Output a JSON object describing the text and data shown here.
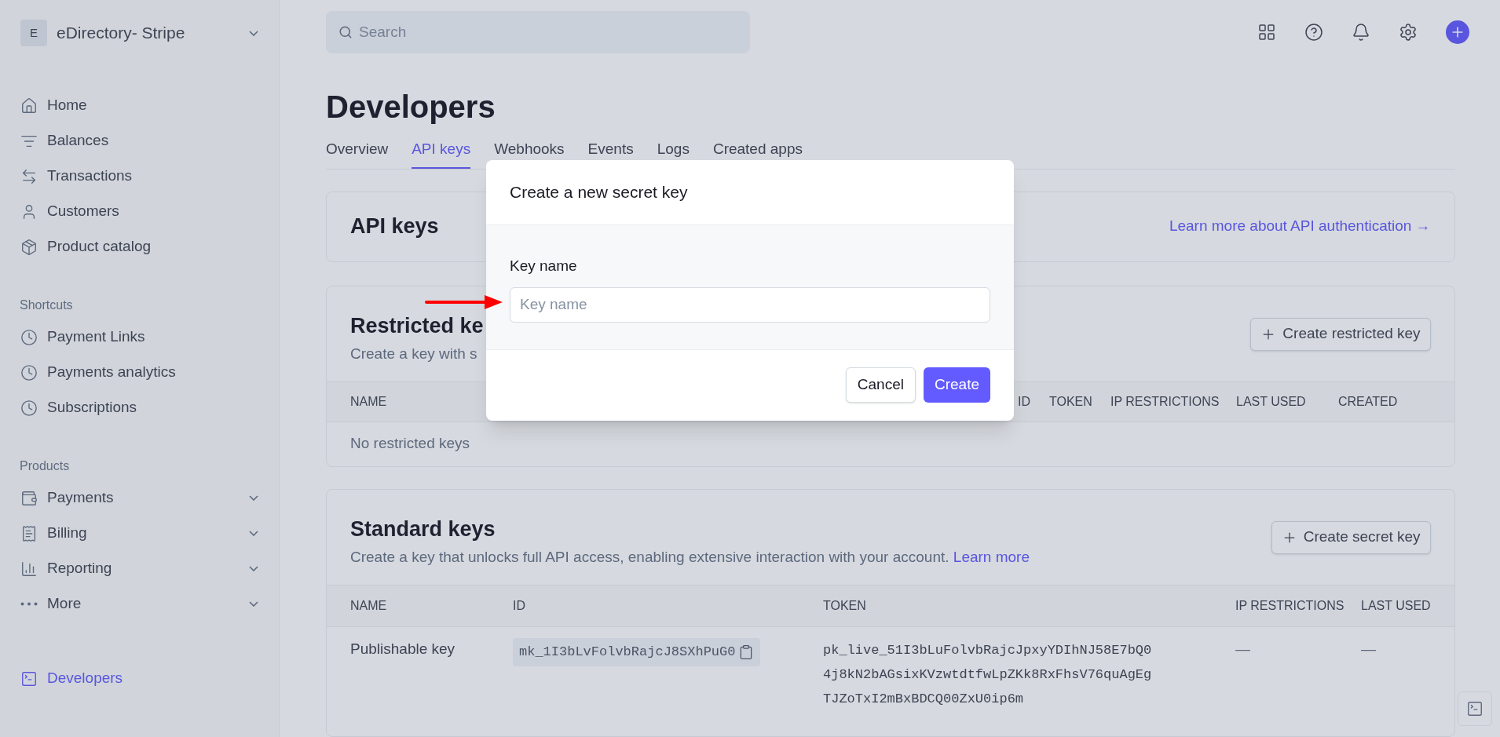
{
  "account": {
    "initial": "E",
    "name": "eDirectory- Stripe"
  },
  "nav": [
    {
      "label": "Home",
      "selected": false
    },
    {
      "label": "Balances",
      "selected": false
    },
    {
      "label": "Transactions",
      "selected": false
    },
    {
      "label": "Customers",
      "selected": false
    },
    {
      "label": "Product catalog",
      "selected": false
    }
  ],
  "shortcuts": {
    "title": "Shortcuts",
    "items": [
      {
        "label": "Payment Links"
      },
      {
        "label": "Payments analytics"
      },
      {
        "label": "Subscriptions"
      }
    ]
  },
  "products": {
    "title": "Products",
    "items": [
      {
        "label": "Payments"
      },
      {
        "label": "Billing"
      },
      {
        "label": "Reporting"
      },
      {
        "label": "More"
      }
    ]
  },
  "developers": {
    "label": "Developers",
    "selected": true
  },
  "search": {
    "placeholder": "Search"
  },
  "page_title": "Developers",
  "tabs": [
    {
      "label": "Overview",
      "selected": false
    },
    {
      "label": "API keys",
      "selected": true
    },
    {
      "label": "Webhooks",
      "selected": false
    },
    {
      "label": "Events",
      "selected": false
    },
    {
      "label": "Logs",
      "selected": false
    },
    {
      "label": "Created apps",
      "selected": false
    }
  ],
  "api_keys_card": {
    "title": "API keys",
    "link": "Learn more about API authentication →"
  },
  "restricted": {
    "title": "Restricted ke",
    "description": "Create a key with s",
    "button": "Create restricted key",
    "columns": [
      "NAME",
      "ID",
      "TOKEN",
      "IP RESTRICTIONS",
      "LAST USED",
      "CREATED"
    ],
    "empty": "No restricted keys"
  },
  "standard": {
    "title": "Standard keys",
    "description": "Create a key that unlocks full API access, enabling extensive interaction with your account.",
    "link": "Learn more",
    "button": "Create secret key",
    "columns": [
      "NAME",
      "ID",
      "TOKEN",
      "IP RESTRICTIONS",
      "LAST USED"
    ],
    "rows": [
      {
        "name": "Publishable key",
        "id": "mk_1I3bLvFolvbRajcJ8SXhPuG0",
        "token": [
          "pk_live_51I3bLuFolvbRajcJpxyYDIhNJ58E7bQ0",
          "4j8kN2bAGsixKVzwtdtfwLpZKk8RxFhsV76quAgEg",
          "TJZoTxI2mBxBDCQ00ZxU0ip6m"
        ],
        "ip": "—",
        "last_used": "—"
      }
    ]
  },
  "modal": {
    "title": "Create a new secret key",
    "field_label": "Key name",
    "placeholder": "Key name",
    "buttons": [
      {
        "label": "Cancel",
        "kind": "secondary"
      },
      {
        "label": "Create",
        "kind": "primary"
      }
    ]
  }
}
